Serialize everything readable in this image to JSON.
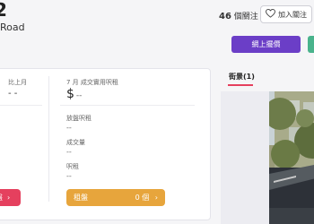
{
  "header": {
    "address_fragment": "2",
    "road": "Road",
    "follower_count": "46",
    "follower_label": "個關注",
    "follow_button": "加入關注",
    "online_offer_button": "網上擺價"
  },
  "stats": {
    "last_month_label": "比上月",
    "last_month_value": "- -",
    "rent_label": "7 月 成交實用呎租",
    "rent_currency": "$",
    "rent_value": "--",
    "listing_rent_label": "放盤呎租",
    "listing_rent_value": "--",
    "volume_label": "成交量",
    "volume_value": "--",
    "yield_label": "呎租",
    "yield_value": "--",
    "left_button_label": "盤",
    "rent_button_label": "租盤",
    "rent_button_count": "0 個"
  },
  "street_view": {
    "tab_label": "街景(1)"
  },
  "colors": {
    "purple": "#6b3ec7",
    "green": "#49b38c",
    "red": "#e5405e",
    "orange": "#e7a53c"
  }
}
